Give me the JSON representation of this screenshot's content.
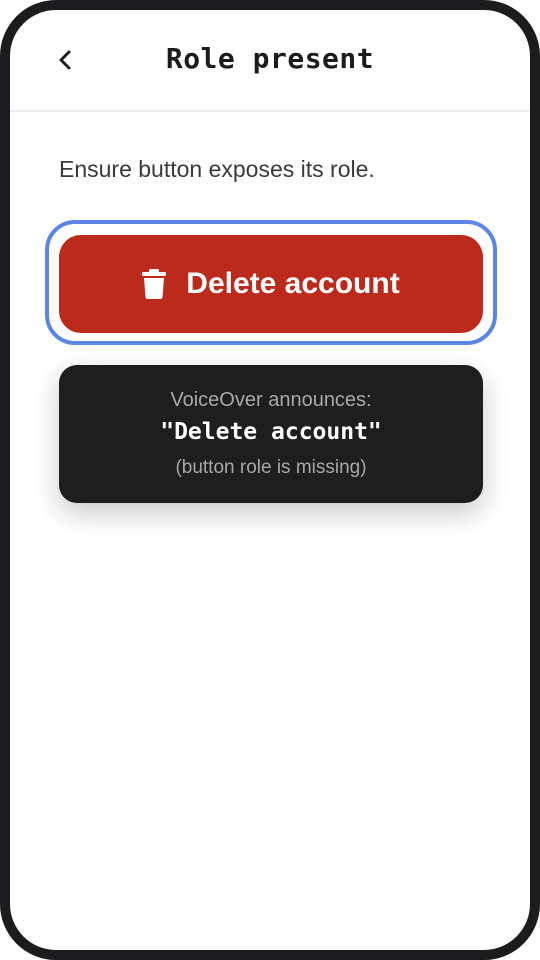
{
  "header": {
    "title": "Role present",
    "back_icon": "chevron-left-icon"
  },
  "main": {
    "description": "Ensure button exposes its role.",
    "delete_button": {
      "label": "Delete account",
      "icon": "trash-icon",
      "background": "#bb2a1a",
      "focus_ring_color": "#5b86e5"
    },
    "voiceover": {
      "heading": "VoiceOver announces:",
      "announcement": "\"Delete account\"",
      "note": "(button role is missing)"
    }
  }
}
